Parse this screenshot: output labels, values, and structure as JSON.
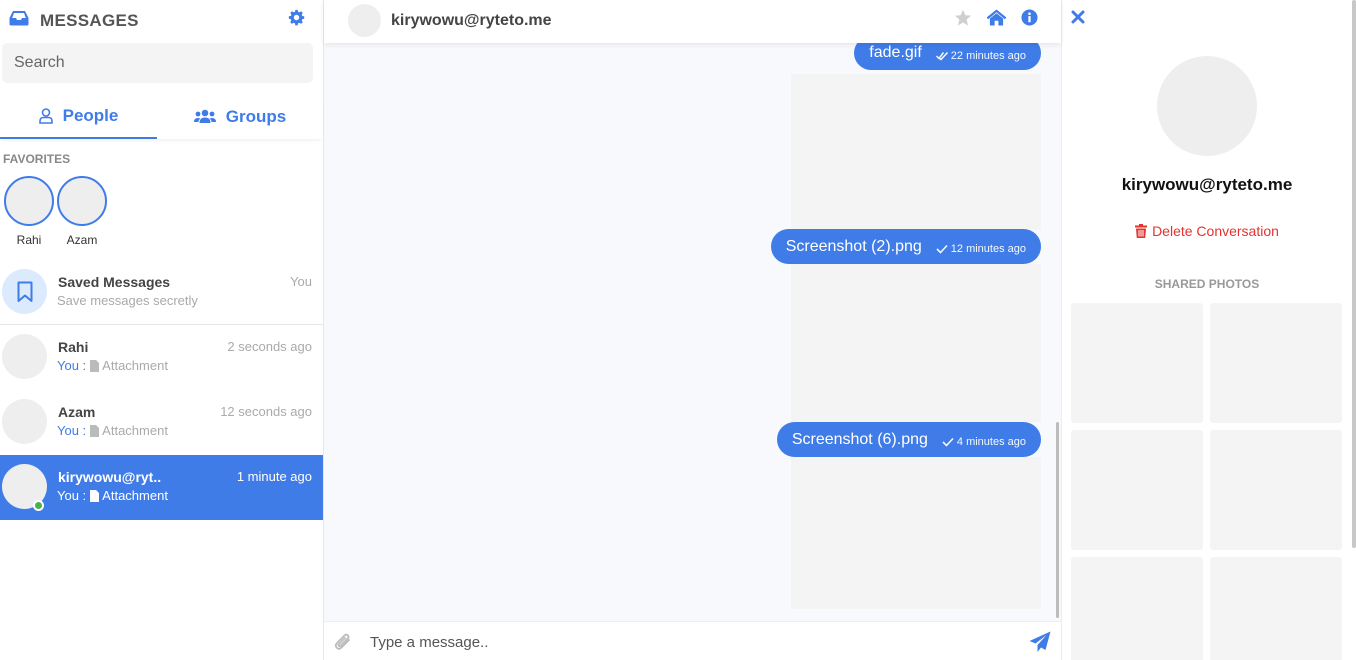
{
  "sidebar": {
    "title": "MESSAGES",
    "search_placeholder": "Search",
    "tabs": [
      {
        "label": "People"
      },
      {
        "label": "Groups"
      }
    ],
    "favorites_heading": "FAVORITES",
    "favorites": [
      {
        "name": "Rahi"
      },
      {
        "name": "Azam"
      }
    ],
    "saved": {
      "name": "Saved Messages",
      "subtitle": "Save messages secretly",
      "badge": "You"
    },
    "contacts": [
      {
        "name": "Rahi",
        "time": "2 seconds ago",
        "you": "You :",
        "preview": "Attachment"
      },
      {
        "name": "Azam",
        "time": "12 seconds ago",
        "you": "You :",
        "preview": "Attachment"
      },
      {
        "name": "kirywowu@ryt..",
        "time": "1 minute ago",
        "you": "You :",
        "preview": "Attachment",
        "active": true,
        "online": true
      }
    ]
  },
  "chat": {
    "contact": "kirywowu@ryteto.me",
    "messages": [
      {
        "text": "fade.gif",
        "time": "22 minutes ago",
        "status": "seen"
      },
      {
        "text": "Screenshot (2).png",
        "time": "12 minutes ago",
        "status": "sent"
      },
      {
        "text": "Screenshot (6).png",
        "time": "4 minutes ago",
        "status": "sent"
      }
    ],
    "input_placeholder": "Type a message.."
  },
  "info": {
    "name": "kirywowu@ryteto.me",
    "delete_label": "Delete Conversation",
    "shared_heading": "SHARED PHOTOS"
  },
  "colors": {
    "accent": "#3f7ce8",
    "danger": "#e3342f",
    "online": "#4caf50"
  }
}
